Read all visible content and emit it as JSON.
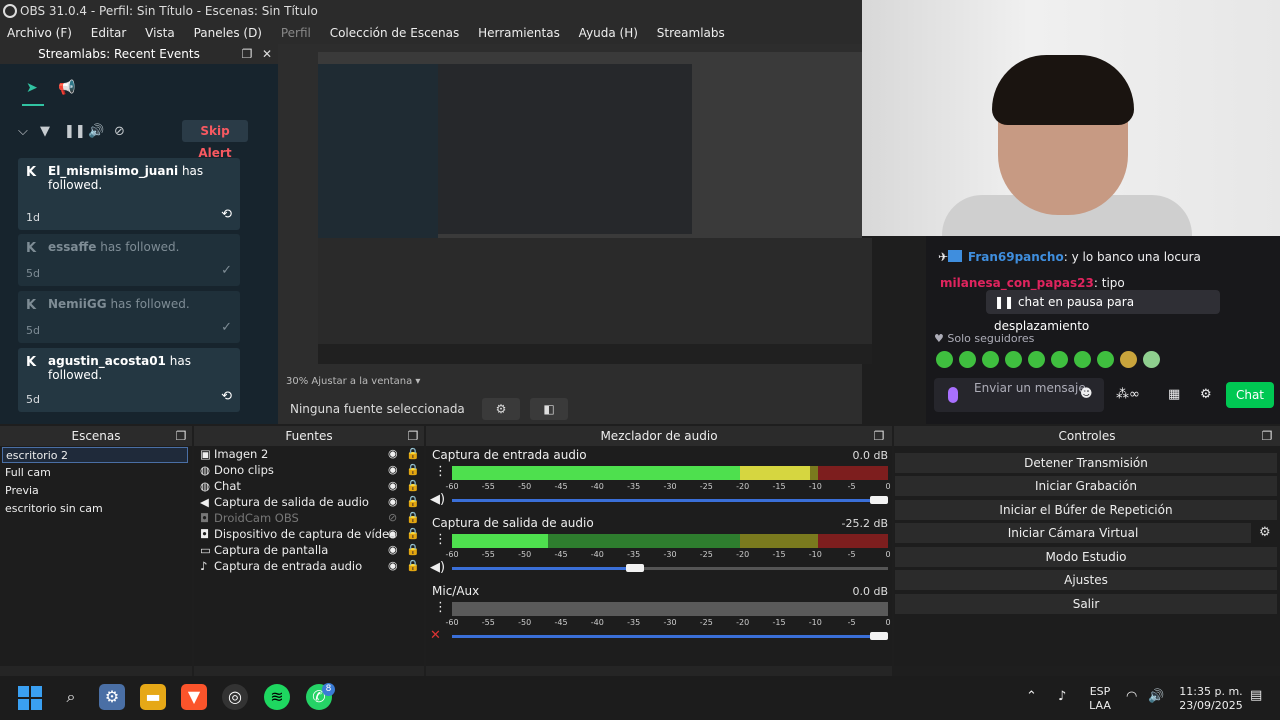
{
  "window": {
    "title": "OBS 31.0.4 - Perfil: Sin Título - Escenas: Sin Título"
  },
  "menu": [
    "Archivo (F)",
    "Editar",
    "Vista",
    "Paneles (D)",
    "Perfil",
    "Colección de Escenas",
    "Herramientas",
    "Ayuda (H)",
    "Streamlabs"
  ],
  "streamlabs": {
    "dock_title": "Streamlabs: Recent Events",
    "skip_alert": "Skip Alert",
    "events": [
      {
        "name": "El_mismisimo_juani",
        "text": "has followed.",
        "age": "1d",
        "action": "repeat-icon"
      },
      {
        "name": "essaffe",
        "text": "has followed.",
        "age": "5d",
        "action": "check-icon"
      },
      {
        "name": "NemiiGG",
        "text": "has followed.",
        "age": "5d",
        "action": "check-icon"
      },
      {
        "name": "agustin_acosta01",
        "text": "has followed.",
        "age": "5d",
        "action": "repeat-icon"
      }
    ]
  },
  "preview": {
    "scale": "30% Ajustar a la ventana",
    "no_source": "Ninguna fuente seleccionada"
  },
  "chat": {
    "messages": [
      {
        "user": "Fran69pancho",
        "text": ": y lo banco una locura",
        "color": "#3f8ede"
      },
      {
        "user": "milanesa_con_papas23",
        "text": ": tipo",
        "color": "#e0245e"
      }
    ],
    "paused": "chat en pausa para desplazamiento",
    "followers_only": "Solo seguidores",
    "input_placeholder": "Enviar un mensaje",
    "chat_button": "Chat"
  },
  "docks": {
    "scenes_title": "Escenas",
    "sources_title": "Fuentes",
    "mixer_title": "Mezclador de audio",
    "controls_title": "Controles"
  },
  "scenes": [
    {
      "name": "escritorio 2",
      "selected": true
    },
    {
      "name": "Full cam",
      "selected": false
    },
    {
      "name": "Previa",
      "selected": false
    },
    {
      "name": "escritorio sin cam",
      "selected": false
    }
  ],
  "sources": [
    {
      "name": "Imagen 2",
      "icon": "image-icon",
      "visible": true
    },
    {
      "name": "Dono clips",
      "icon": "browser-icon",
      "visible": true
    },
    {
      "name": "Chat",
      "icon": "browser-icon",
      "visible": true
    },
    {
      "name": "Captura de salida de audio",
      "icon": "speaker-icon",
      "visible": true
    },
    {
      "name": "DroidCam OBS",
      "icon": "camera-icon",
      "visible": false
    },
    {
      "name": "Dispositivo de captura de vídeo",
      "icon": "camera-icon",
      "visible": true
    },
    {
      "name": "Captura de pantalla",
      "icon": "monitor-icon",
      "visible": true
    },
    {
      "name": "Captura de entrada audio",
      "icon": "mic-icon",
      "visible": true
    }
  ],
  "mixer": {
    "ticks": [
      "-60",
      "-55",
      "-50",
      "-45",
      "-40",
      "-35",
      "-30",
      "-25",
      "-20",
      "-15",
      "-10",
      "-5",
      "0"
    ],
    "channels": [
      {
        "name": "Captura de entrada audio",
        "db": "0.0 dB",
        "level": 0.82,
        "fader": 1.0,
        "muted": false
      },
      {
        "name": "Captura de salida de audio",
        "db": "-25.2 dB",
        "level": 0.22,
        "fader": 0.42,
        "muted": false
      },
      {
        "name": "Mic/Aux",
        "db": "0.0 dB",
        "level": 0.0,
        "fader": 1.0,
        "muted": true
      }
    ]
  },
  "controls": [
    "Detener Transmisión",
    "Iniciar Grabación",
    "Iniciar el Búfer de Repetición",
    "Iniciar Cámara Virtual",
    "Modo Estudio",
    "Ajustes",
    "Salir"
  ],
  "taskbar": {
    "lang": "ESP",
    "lang2": "LAA",
    "time": "11:35 p. m.",
    "date": "23/09/2025",
    "whatsapp_badge": "8"
  },
  "colors": {
    "accent": "#31c3a2",
    "skip_alert": "#f85961",
    "chat_green": "#00c853"
  }
}
